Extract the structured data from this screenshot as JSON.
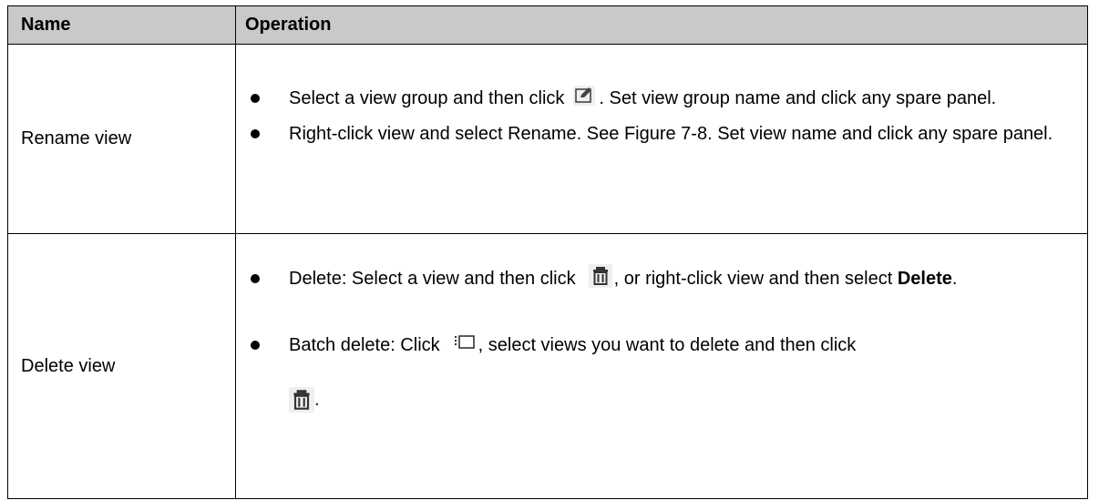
{
  "header": {
    "name": "Name",
    "operation": "Operation"
  },
  "rows": [
    {
      "name": "Rename view",
      "bullets": [
        {
          "before_icon": "Select a view group and then click",
          "icon": "edit-icon",
          "after_icon": ". Set view group name and click any spare panel."
        },
        {
          "text": "Right-click view and select Rename. See Figure 7-8. Set view name and click any spare panel."
        }
      ]
    },
    {
      "name": "Delete view",
      "bullets": [
        {
          "before_icon": "Delete: Select a view and then click",
          "icon": "trash-icon",
          "after_icon_1": ", or right-click view and then select ",
          "bold": "Delete",
          "after_bold": "."
        },
        {
          "before_icon": "Batch delete: Click",
          "icon": "batch-select-icon",
          "after_icon": ", select views you want to delete and then click",
          "icon2": "trash-icon",
          "end": "."
        }
      ]
    }
  ]
}
